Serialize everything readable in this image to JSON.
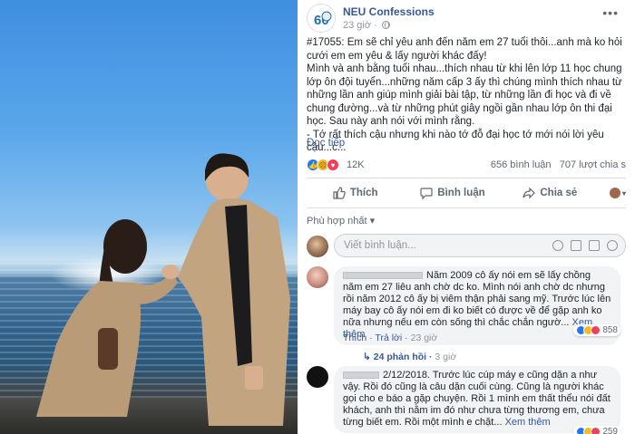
{
  "post": {
    "page_name": "NEU Confessions",
    "time": "23 giờ",
    "logo_text": "60",
    "body": "#17055: Em sẽ chỉ yêu anh đến năm em 27 tuổi thôi...anh mà ko hỏi cưới em em yêu & lấy người khác đấy!\nMình và anh bằng tuổi nhau...thích nhau từ khi lên lớp 11 học chung lớp ôn đội tuyển...những năm cấp 3 ấy thì chúng mình thích nhau từ những lần anh giúp mình giải bài tập, từ những lần đi học và đi về chung đường...và từ những phút giây ngồi gần nhau lớp ôn thi đại học. Sau này anh nói với mình rằng.\n- Tớ rất thích cậu nhưng khi nào tớ đỗ đại học tớ mới nói lời yêu cậu...c...",
    "see_more": "Đọc tiếp",
    "reaction_count": "12K",
    "comments_count": "656 bình luận",
    "shares_count": "707 lượt chia s"
  },
  "actions": {
    "like": "Thích",
    "comment": "Bình luận",
    "share": "Chia sẻ"
  },
  "sort_label": "Phù hợp nhất ▾",
  "comment_input": {
    "placeholder": "Viết bình luận..."
  },
  "comments": [
    {
      "text": "Năm 2009 cô ấy nói em sẽ lấy chồng năm em 27 liêu anh chờ dc ko. Mình nói anh chờ dc nhưng rồi năm 2012 cô ấy bị viêm thận phải sang mỹ. Trước lúc lên máy bay cô ấy nói em đi ko biết có được về để gặp anh ko nữa nhưng nếu em còn sống thì chắc chắn ngườ...",
      "see_more": "Xem thêm",
      "like": "Thích",
      "reply": "Trả lời",
      "time": "23 giờ",
      "reactions": "858",
      "replies": "24 phản hồi",
      "replies_time": "3 giờ"
    },
    {
      "text": "2/12/2018. Trước lúc cúp máy e cũng dặn a như vậy. Rồi đó cũng là câu dặn cuối cùng. Cũng là người khác gọi cho e báo a gặp chuyện. Rồi 1 mình em thất thểu nói đất khách, anh thì nằm im đó như chưa từng thương em, chưa từng biết em. Rồi một mình e chặt...",
      "see_more": "Xem thêm",
      "reactions": "259"
    }
  ],
  "colors": {
    "link": "#365899",
    "like_blue": "#2078f4",
    "love_red": "#f33e58",
    "sad_yellow": "#f7b928"
  },
  "icons": [
    "globe-icon",
    "more-icon",
    "like-icon",
    "comment-icon",
    "share-icon",
    "emoji-icon",
    "camera-icon",
    "gif-icon",
    "sticker-icon"
  ]
}
